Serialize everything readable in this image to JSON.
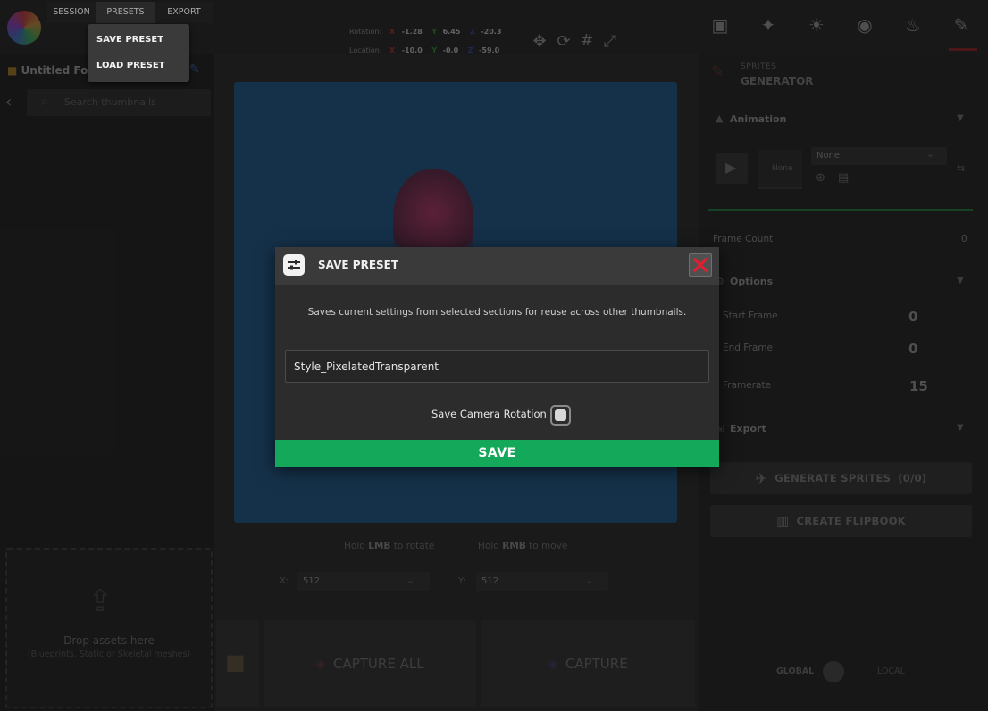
{
  "menu": {
    "session": "SESSION",
    "presets": "PRESETS",
    "export": "EXPORT"
  },
  "presets_dropdown": {
    "save": "SAVE PRESET",
    "load": "LOAD PRESET"
  },
  "left": {
    "folder_name": "Untitled Fol",
    "search_placeholder": "Search thumbnails",
    "drop_title": "Drop assets here",
    "drop_subtitle": "(Blueprints, Static or Skeletal meshes)"
  },
  "transform": {
    "rotation_label": "Rotation:",
    "location_label": "Location:",
    "axis_x": "X",
    "axis_y": "Y",
    "axis_z": "Z",
    "rotation": {
      "x": "-1.28",
      "y": "6.45",
      "z": "-20.3"
    },
    "location": {
      "x": "-10.0",
      "y": "-0.0",
      "z": "-59.0"
    }
  },
  "viewport": {
    "hint_rotate_pre": "Hold",
    "hint_rotate_key": "LMB",
    "hint_rotate_post": "to rotate",
    "hint_move_pre": "Hold",
    "hint_move_key": "RMB",
    "hint_move_post": "to move",
    "x_label": "X:",
    "x_value": "512",
    "y_label": "Y:",
    "y_value": "512",
    "capture_all": "CAPTURE ALL",
    "capture": "CAPTURE"
  },
  "right": {
    "section_small": "SPRITES",
    "section_big": "GENERATOR",
    "animation_header": "Animation",
    "none_left": "None",
    "none_select": "None",
    "frame_count_label": "Frame Count",
    "frame_count_value": "0",
    "options_header": "Options",
    "start_frame_label": "Start Frame",
    "start_frame_value": "0",
    "end_frame_label": "End Frame",
    "end_frame_value": "0",
    "framerate_label": "Framerate",
    "framerate_value": "15",
    "export_header": "Export",
    "generate_sprites": "GENERATE SPRITES",
    "generate_sprites_count": "(0/0)",
    "create_flipbook": "CREATE FLIPBOOK",
    "global_label": "GLOBAL",
    "local_label": "LOCAL"
  },
  "modal": {
    "title": "SAVE PRESET",
    "description": "Saves current settings from selected sections for reuse across other thumbnails.",
    "input_value": "Style_PixelatedTransparent",
    "checkbox_label": "Save Camera Rotation",
    "checkbox_checked": "true",
    "save_label": "SAVE",
    "close_color": "#e02030",
    "save_color": "#14a85a"
  }
}
